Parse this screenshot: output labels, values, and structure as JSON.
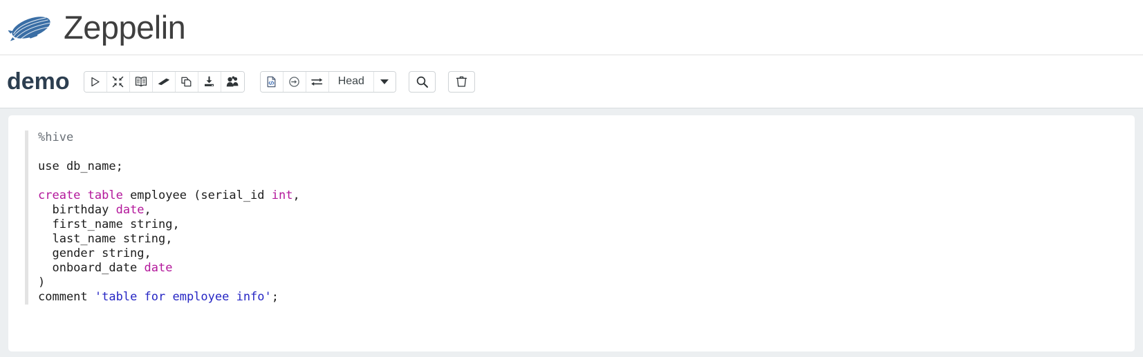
{
  "brand": {
    "name": "Zeppelin",
    "logo_icon": "zeppelin-airship-icon",
    "logo_color": "#3a6ea5"
  },
  "notebook": {
    "title": "demo",
    "toolbar": {
      "group_primary": [
        {
          "icon": "play-icon",
          "name": "run-all-paragraphs-button",
          "title": "Run all paragraphs"
        },
        {
          "icon": "collapse-arrows-icon",
          "name": "show-hide-code-button",
          "title": "Show/hide the code"
        },
        {
          "icon": "book-icon",
          "name": "show-hide-output-button",
          "title": "Show/hide the output"
        },
        {
          "icon": "eraser-icon",
          "name": "clear-output-button",
          "title": "Clear output"
        },
        {
          "icon": "copy-pages-icon",
          "name": "clone-note-button",
          "title": "Clone the note"
        },
        {
          "icon": "import-tray-icon",
          "name": "export-note-button",
          "title": "Export the note"
        },
        {
          "icon": "users-icon",
          "name": "permissions-button",
          "title": "Permissions"
        }
      ],
      "group_secondary": [
        {
          "icon": "code-file-icon",
          "name": "interpreter-binding-button",
          "title": "Interpreter binding"
        },
        {
          "icon": "circle-arrow-right-icon",
          "name": "run-on-selection-button",
          "title": "Run"
        },
        {
          "icon": "swap-arrows-icon",
          "name": "version-control-button",
          "title": "Version control"
        }
      ],
      "revision_label": "Head",
      "revision_caret_icon": "chevron-down-icon",
      "search_icon": "search-icon",
      "search_name": "search-code-button",
      "delete_icon": "trash-icon",
      "delete_name": "delete-note-button"
    }
  },
  "paragraph": {
    "interpreter": "%hive",
    "code_lines": [
      [
        {
          "t": "%hive",
          "c": "tok-directive"
        }
      ],
      [
        {
          "t": "",
          "c": "tok-plain"
        }
      ],
      [
        {
          "t": "use db_name;",
          "c": "tok-plain"
        }
      ],
      [
        {
          "t": "",
          "c": "tok-plain"
        }
      ],
      [
        {
          "t": "create table",
          "c": "tok-keyword"
        },
        {
          "t": " employee (serial_id ",
          "c": "tok-plain"
        },
        {
          "t": "int",
          "c": "tok-type"
        },
        {
          "t": ",",
          "c": "tok-plain"
        }
      ],
      [
        {
          "t": "  birthday ",
          "c": "tok-plain"
        },
        {
          "t": "date",
          "c": "tok-type"
        },
        {
          "t": ",",
          "c": "tok-plain"
        }
      ],
      [
        {
          "t": "  first_name string,",
          "c": "tok-plain"
        }
      ],
      [
        {
          "t": "  last_name string,",
          "c": "tok-plain"
        }
      ],
      [
        {
          "t": "  gender string,",
          "c": "tok-plain"
        }
      ],
      [
        {
          "t": "  onboard_date ",
          "c": "tok-plain"
        },
        {
          "t": "date",
          "c": "tok-type"
        }
      ],
      [
        {
          "t": ")",
          "c": "tok-plain"
        }
      ],
      [
        {
          "t": "comment ",
          "c": "tok-plain"
        },
        {
          "t": "'table for employee info'",
          "c": "tok-string"
        },
        {
          "t": ";",
          "c": "tok-plain"
        }
      ]
    ]
  }
}
